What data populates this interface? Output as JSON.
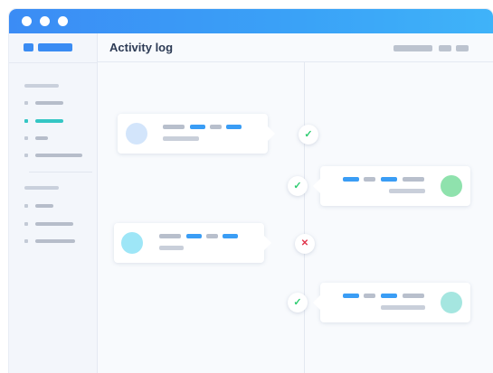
{
  "window": {
    "title_dots": [
      "dot",
      "dot",
      "dot"
    ]
  },
  "header": {
    "title": "Activity log"
  },
  "sidebar": {
    "groups": [
      {
        "items": [
          {
            "state": "inactive"
          },
          {
            "state": "active"
          },
          {
            "state": "inactive"
          },
          {
            "state": "inactive"
          }
        ]
      },
      {
        "items": [
          {
            "state": "inactive"
          },
          {
            "state": "inactive"
          },
          {
            "state": "inactive"
          }
        ]
      }
    ]
  },
  "activity": [
    {
      "side": "left",
      "status": "success",
      "status_icon": "✓",
      "avatar_color": "#d3e5fb"
    },
    {
      "side": "right",
      "status": "success",
      "status_icon": "✓",
      "avatar_color": "#8fe2ad"
    },
    {
      "side": "left",
      "status": "failure",
      "status_icon": "✕",
      "avatar_color": "#9ee6f7"
    },
    {
      "side": "right",
      "status": "success",
      "status_icon": "✓",
      "avatar_color": "#a5e6e0"
    }
  ],
  "colors": {
    "accent": "#3a8cf3",
    "active_teal": "#34c6c4",
    "success": "#2ecc71",
    "failure": "#e0344b"
  }
}
